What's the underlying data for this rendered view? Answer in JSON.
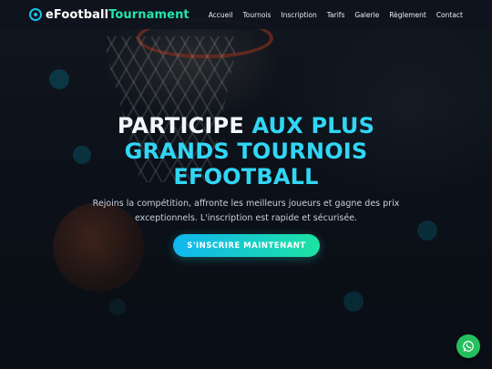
{
  "brand": {
    "part1": "eFootball",
    "part2": "Tournament",
    "icon": "soccer-ball-icon"
  },
  "nav": {
    "items": [
      {
        "label": "Accueil"
      },
      {
        "label": "Tournois"
      },
      {
        "label": "Inscription"
      },
      {
        "label": "Tarifs"
      },
      {
        "label": "Galerie"
      },
      {
        "label": "Règlement"
      },
      {
        "label": "Contact"
      }
    ]
  },
  "hero": {
    "title_line1_a": "PARTICIPE",
    "title_line1_b": "AUX PLUS",
    "title_line2": "GRANDS TOURNOIS",
    "title_line3": "EFOOTBALL",
    "subtitle": "Rejoins la compétition, affronte les meilleurs joueurs et gagne des prix exceptionnels. L'inscription est rapide et sécurisée.",
    "cta": "S'INSCRIRE MAINTENANT"
  },
  "floating": {
    "icon": "whatsapp-icon"
  },
  "colors": {
    "accent": "#31d6f5",
    "accent2": "#21e6a8",
    "whatsapp": "#25c05e"
  }
}
